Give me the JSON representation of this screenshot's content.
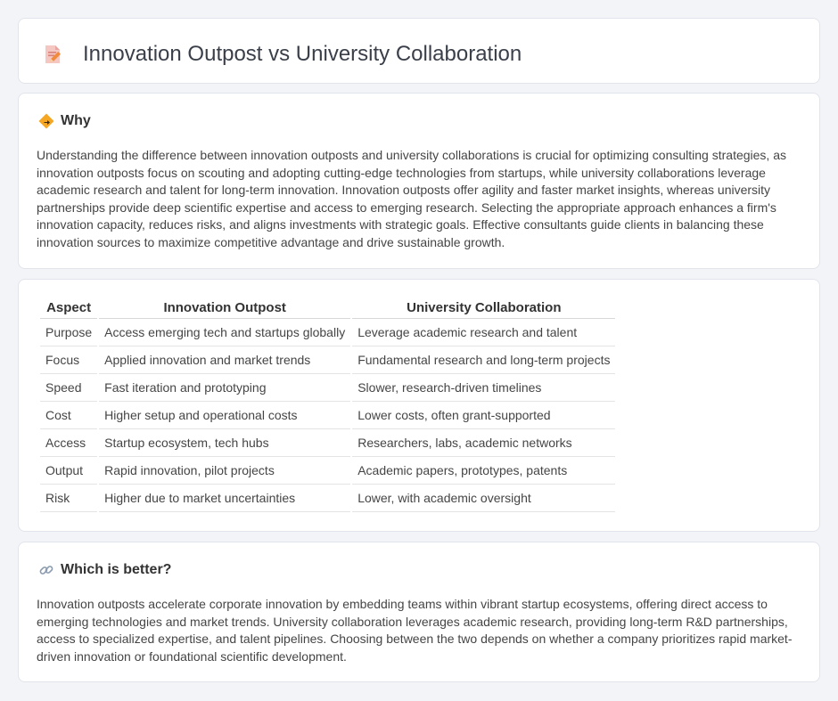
{
  "header": {
    "title": "Innovation Outpost vs University Collaboration",
    "icon": "document-pencil-icon"
  },
  "why": {
    "heading": "Why",
    "icon": "diamond-sign-icon",
    "text": "Understanding the difference between innovation outposts and university collaborations is crucial for optimizing consulting strategies, as innovation outposts focus on scouting and adopting cutting-edge technologies from startups, while university collaborations leverage academic research and talent for long-term innovation. Innovation outposts offer agility and faster market insights, whereas university partnerships provide deep scientific expertise and access to emerging research. Selecting the appropriate approach enhances a firm's innovation capacity, reduces risks, and aligns investments with strategic goals. Effective consultants guide clients in balancing these innovation sources to maximize competitive advantage and drive sustainable growth."
  },
  "comparison": {
    "headers": [
      "Aspect",
      "Innovation Outpost",
      "University Collaboration"
    ],
    "rows": [
      [
        "Purpose",
        "Access emerging tech and startups globally",
        "Leverage academic research and talent"
      ],
      [
        "Focus",
        "Applied innovation and market trends",
        "Fundamental research and long-term projects"
      ],
      [
        "Speed",
        "Fast iteration and prototyping",
        "Slower, research-driven timelines"
      ],
      [
        "Cost",
        "Higher setup and operational costs",
        "Lower costs, often grant-supported"
      ],
      [
        "Access",
        "Startup ecosystem, tech hubs",
        "Researchers, labs, academic networks"
      ],
      [
        "Output",
        "Rapid innovation, pilot projects",
        "Academic papers, prototypes, patents"
      ],
      [
        "Risk",
        "Higher due to market uncertainties",
        "Lower, with academic oversight"
      ]
    ]
  },
  "better": {
    "heading": "Which is better?",
    "icon": "link-icon",
    "text": "Innovation outposts accelerate corporate innovation by embedding teams within vibrant startup ecosystems, offering direct access to emerging technologies and market trends. University collaboration leverages academic research, providing long-term R&D partnerships, access to specialized expertise, and talent pipelines. Choosing between the two depends on whether a company prioritizes rapid market-driven innovation or foundational scientific development."
  }
}
